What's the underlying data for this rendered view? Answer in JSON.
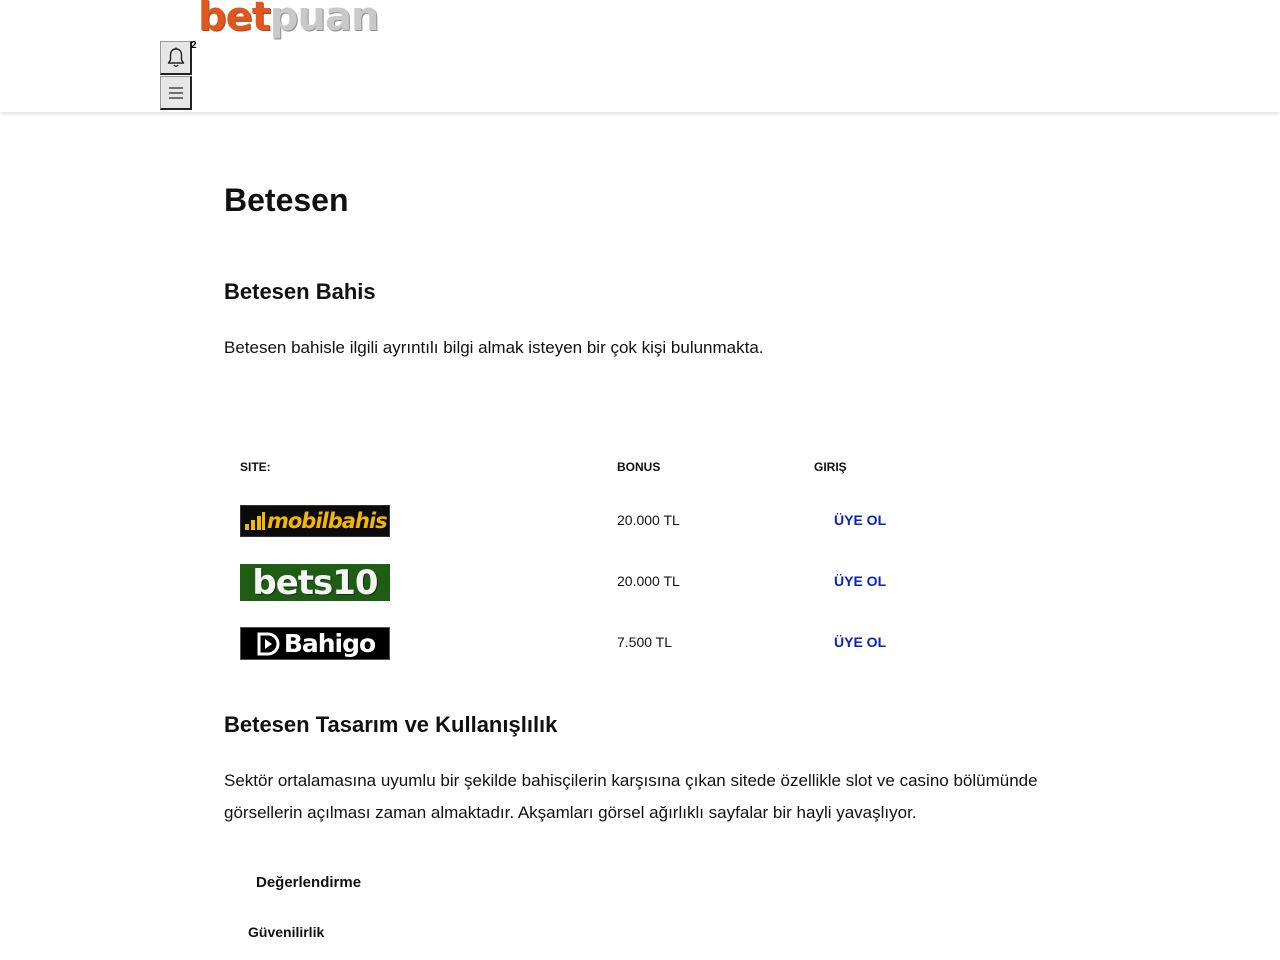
{
  "header": {
    "logo_part1": "bet",
    "logo_part2": "puan",
    "notification_count": "2"
  },
  "article": {
    "title": "Betesen",
    "section1_heading": "Betesen Bahis",
    "section1_text": "Betesen bahisle ilgili ayrıntılı bilgi almak isteyen bir çok kişi bulunmakta.",
    "section2_heading": "Betesen Tasarım ve Kullanışlılık",
    "section2_text": "Sektör ortalamasına uyumlu bir şekilde bahisçilerin karşısına çıkan sitede özellikle slot ve casino bölümünde görsellerin açılması zaman almaktadır. Akşamları görsel ağırlıklı sayfalar bir hayli yavaşlıyor.",
    "rating_label": "Değerlendirme",
    "security_label": "Güvenilirlik"
  },
  "table": {
    "headers": [
      "SITE:",
      "BONUS",
      "GIRIŞ"
    ],
    "rows": [
      {
        "logo_text": "mobilbahis",
        "bonus": "20.000 TL",
        "cta": "ÜYE OL"
      },
      {
        "logo_text": "bets10",
        "bonus": "20.000 TL",
        "cta": "ÜYE OL"
      },
      {
        "logo_text": "Bahigo",
        "bonus": "7.500 TL",
        "cta": "ÜYE OL"
      }
    ]
  },
  "icons": {
    "notification": "bell-icon",
    "menu": "hamburger-menu-icon"
  },
  "colors": {
    "logo_orange": "#e0561f",
    "cta_blue": "#0a22c4",
    "bets10_green": "#1f5c14",
    "mobilbahis_yellow": "#f2b705"
  }
}
